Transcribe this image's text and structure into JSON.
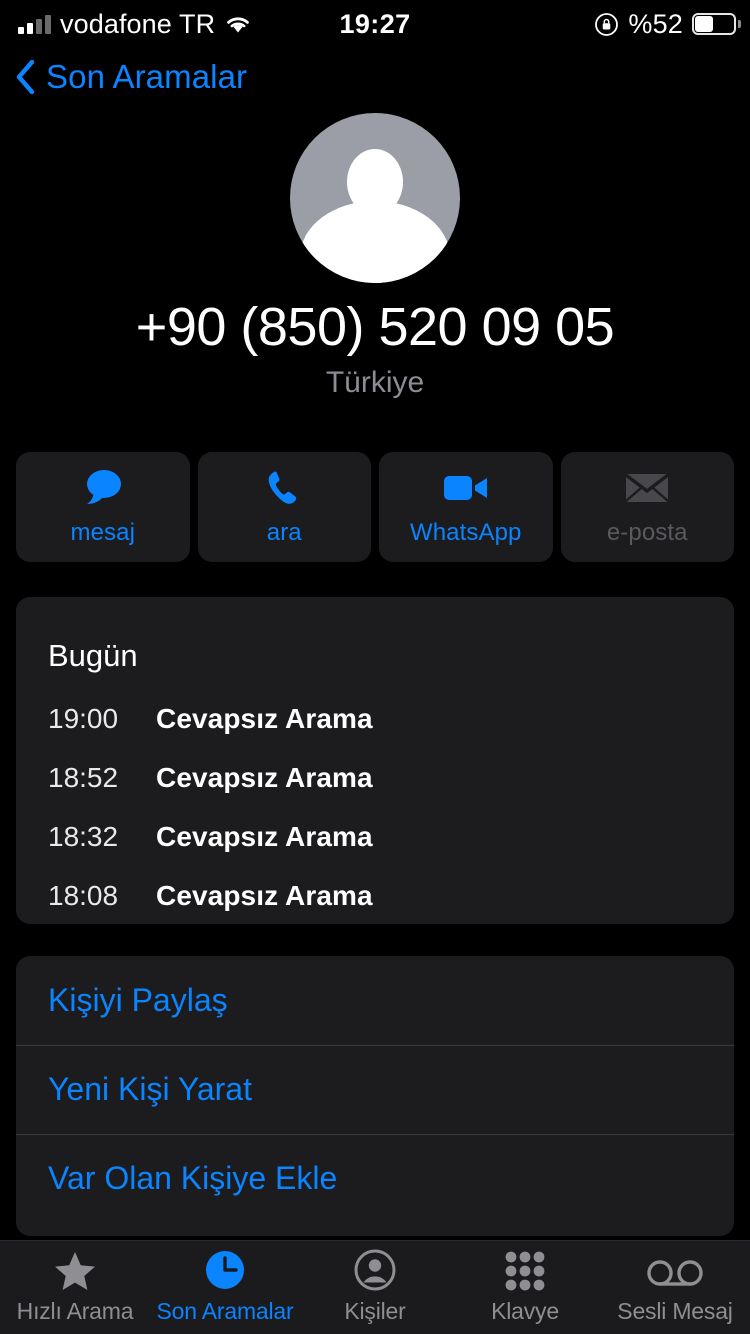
{
  "status_bar": {
    "carrier": "vodafone TR",
    "time": "19:27",
    "battery_percent": "%52",
    "signal_icon": "signal-bars-icon",
    "wifi_icon": "wifi-icon",
    "rotation_lock_icon": "rotation-lock-icon",
    "battery_icon": "battery-icon"
  },
  "nav": {
    "back_label": "Son Aramalar",
    "back_icon": "chevron-left-icon"
  },
  "contact": {
    "avatar_icon": "default-person-avatar-icon",
    "phone_number": "+90 (850) 520 09 05",
    "region": "Türkiye"
  },
  "actions": [
    {
      "label": "mesaj",
      "icon": "message-bubble-icon",
      "enabled": true
    },
    {
      "label": "ara",
      "icon": "phone-handset-icon",
      "enabled": true
    },
    {
      "label": "WhatsApp",
      "icon": "video-camera-icon",
      "enabled": true
    },
    {
      "label": "e-posta",
      "icon": "envelope-icon",
      "enabled": false
    }
  ],
  "history": {
    "title": "Bugün",
    "entries": [
      {
        "time": "19:00",
        "type": "Cevapsız Arama"
      },
      {
        "time": "18:52",
        "type": "Cevapsız Arama"
      },
      {
        "time": "18:32",
        "type": "Cevapsız Arama"
      },
      {
        "time": "18:08",
        "type": "Cevapsız Arama"
      }
    ]
  },
  "options": [
    {
      "label": "Kişiyi Paylaş"
    },
    {
      "label": "Yeni Kişi Yarat"
    },
    {
      "label": "Var Olan Kişiye Ekle"
    }
  ],
  "tabs": [
    {
      "label": "Hızlı Arama",
      "icon": "star-icon",
      "active": false
    },
    {
      "label": "Son Aramalar",
      "icon": "clock-icon",
      "active": true
    },
    {
      "label": "Kişiler",
      "icon": "person-circle-icon",
      "active": false
    },
    {
      "label": "Klavye",
      "icon": "keypad-icon",
      "active": false
    },
    {
      "label": "Sesli Mesaj",
      "icon": "voicemail-icon",
      "active": false
    }
  ],
  "colors": {
    "accent": "#0a84ff",
    "background": "#000000",
    "card": "#1c1c1e",
    "secondary_text": "#8e8e93",
    "disabled_text": "#59595e"
  }
}
